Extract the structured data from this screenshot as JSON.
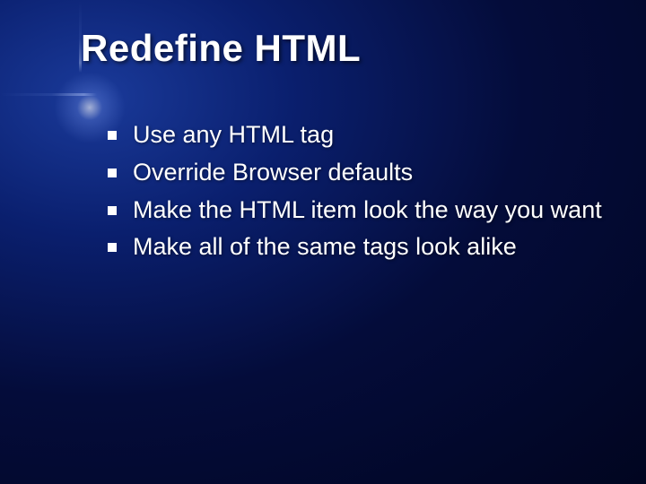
{
  "slide": {
    "title": "Redefine HTML",
    "bullets": [
      "Use any HTML tag",
      "Override Browser defaults",
      "Make the HTML item look the way you want",
      "Make all of the same tags look alike"
    ]
  }
}
